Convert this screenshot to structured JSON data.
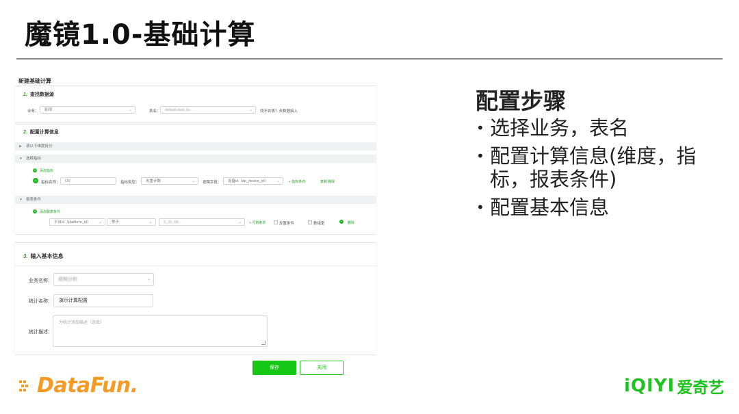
{
  "slide": {
    "title": "魔镜1.0-基础计算",
    "steps_title": "配置步骤",
    "bullets": [
      "选择业务，表名",
      "配置计算信息(维度，指标，报表条件)",
      "配置基本信息"
    ]
  },
  "form": {
    "page_title": "新建基础计算",
    "section1": {
      "num": "1.",
      "title": "查找数据源",
      "business_label": "业务：",
      "business_value": "影视",
      "table_label": "表名：",
      "table_value": "default.dwd_liv...",
      "table_hint": "找不到表？去数据接入"
    },
    "section2": {
      "num": "2.",
      "title": "配置计算信息",
      "band_dims": "请以下维度拆分",
      "band_metrics": "选择指标",
      "add_metric": "添加指标",
      "metric_name_label": "指标名称：",
      "metric_name_value": "UV",
      "metric_type_label": "指标类型：",
      "metric_type_value": "去重计数",
      "field_label": "按照字段：",
      "field_value": "设备id（dp_device_id）",
      "add_condition": "+ 指标条件",
      "copy_delete": "复制  删除",
      "band_conditions": "报表条件",
      "add_report_condition": "添加报表条件",
      "cond_field": "平台id（platform_id）",
      "cond_op": "等于",
      "cond_value": "2_10_68...",
      "add_sibling": "+ 兄弟条件",
      "and_cond": "反置条件",
      "array_label": "数组型",
      "delete": "删除"
    },
    "section3": {
      "num": "3.",
      "title": "输入基本信息",
      "business_name_label": "业务名称：",
      "business_name_value": "视频分析",
      "stat_name_label": "统计名称：",
      "stat_name_value": "演示计算配置",
      "stat_desc_label": "统计描述：",
      "stat_desc_placeholder": "为统计添加描述（选填）"
    },
    "save_label": "保存",
    "close_label": "关闭"
  },
  "footer": {
    "left_logo": "DataFun.",
    "right_logo_latin": "iQIYI",
    "right_logo_cn": "爱奇艺"
  },
  "colors": {
    "accent_green": "#16c716",
    "datafun_orange": "#f59a23",
    "iqiyi_green": "#1fc31f"
  }
}
